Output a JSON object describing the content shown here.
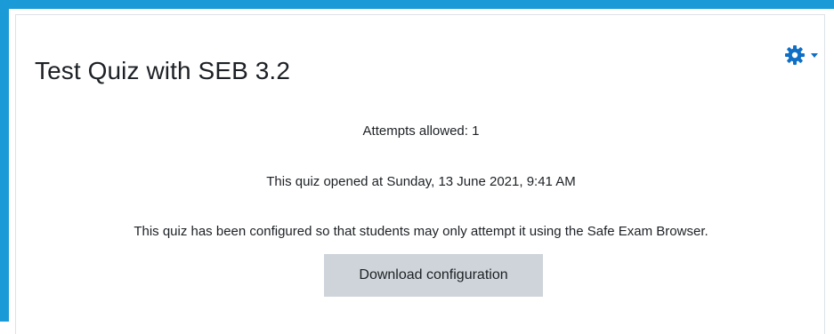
{
  "quiz": {
    "title": "Test Quiz with SEB 3.2",
    "attempts_allowed": "Attempts allowed: 1",
    "opened_at": "This quiz opened at Sunday, 13 June 2021, 9:41 AM",
    "seb_requirement": "This quiz has been configured so that students may only attempt it using the Safe Exam Browser.",
    "download_label": "Download configuration"
  },
  "actions_menu": {
    "icon": "gear-icon",
    "dropdown_icon": "caret-down-icon"
  },
  "colors": {
    "accent": "#1a9ad6",
    "link": "#0f6fc5",
    "button_bg": "#ced4da",
    "text": "#1d2125"
  }
}
